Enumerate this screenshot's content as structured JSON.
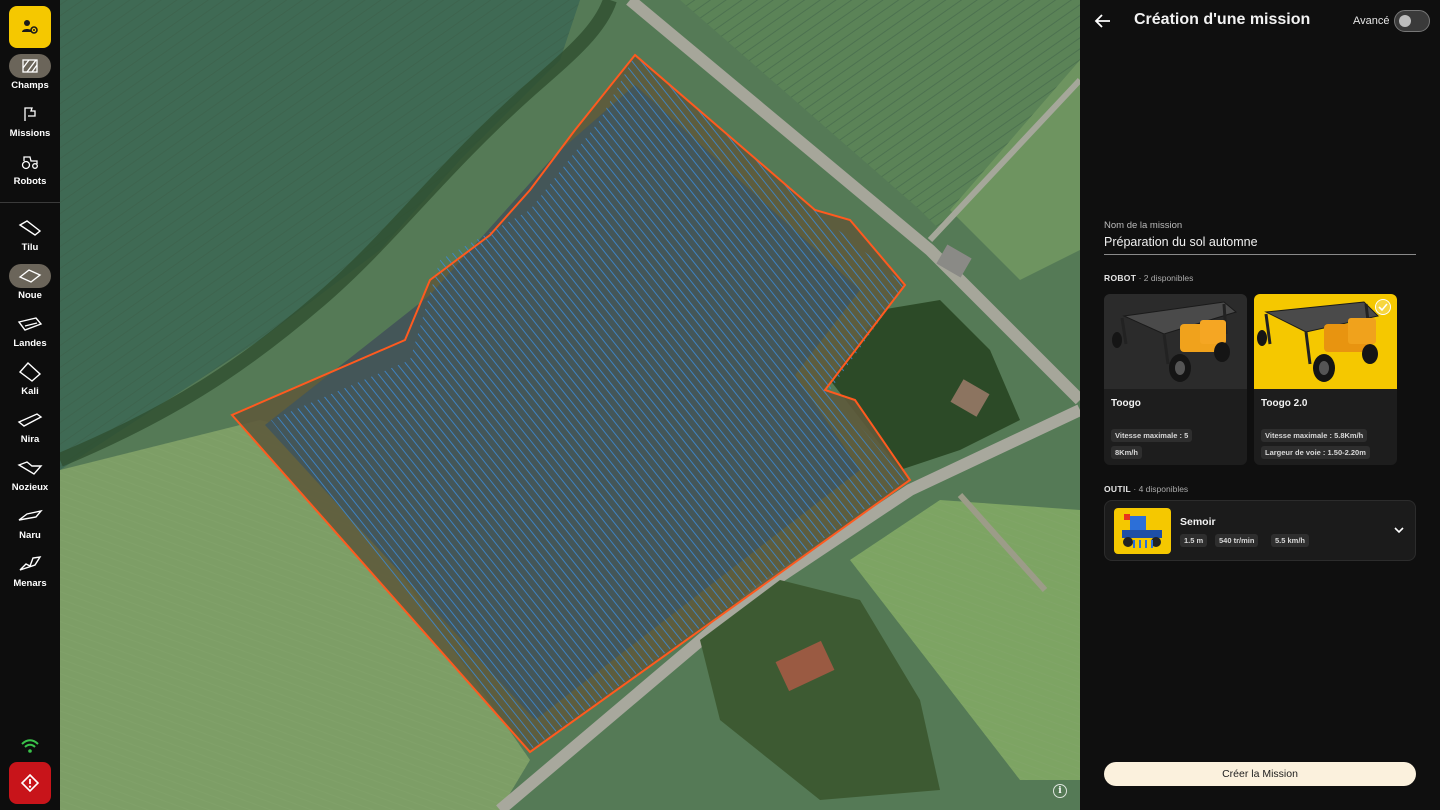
{
  "sidebar": {
    "logo_icon": "farmer-settings-icon",
    "items": [
      {
        "label": "Champs",
        "icon": "field-hatch-icon",
        "active": true
      },
      {
        "label": "Missions",
        "icon": "flag-route-icon",
        "active": false
      },
      {
        "label": "Robots",
        "icon": "tractor-icon",
        "active": false
      },
      {
        "label": "Tilu",
        "icon": "parcel-shape-icon",
        "active": false
      },
      {
        "label": "Noue",
        "icon": "parcel-shape-icon",
        "active": true
      },
      {
        "label": "Landes",
        "icon": "parcel-shape-icon",
        "active": false
      },
      {
        "label": "Kali",
        "icon": "parcel-shape-icon",
        "active": false
      },
      {
        "label": "Nira",
        "icon": "parcel-shape-icon",
        "active": false
      },
      {
        "label": "Nozieux",
        "icon": "parcel-shape-icon",
        "active": false
      },
      {
        "label": "Naru",
        "icon": "parcel-shape-icon",
        "active": false
      },
      {
        "label": "Menars",
        "icon": "parcel-shape-icon",
        "active": false
      }
    ],
    "status_icon": "wifi-icon",
    "emergency_icon": "emergency-stop-icon"
  },
  "map": {
    "info_label": "i"
  },
  "panel": {
    "title": "Création d'une mission",
    "advanced_label": "Avancé",
    "advanced_on": false,
    "mission_name_label": "Nom de la mission",
    "mission_name_value": "Préparation du sol automne",
    "robot_section": {
      "title": "ROBOT",
      "sub": "· 2 disponibles"
    },
    "robots": [
      {
        "name": "Toogo",
        "specs": [
          "Vitesse maximale : 5",
          "8Km/h"
        ],
        "selected": false
      },
      {
        "name": "Toogo 2.0",
        "specs": [
          "Vitesse maximale : 5.8Km/h",
          "Largeur de voie : 1.50-2.20m"
        ],
        "selected": true
      }
    ],
    "tool_section": {
      "title": "OUTIL",
      "sub": "· 4 disponibles"
    },
    "tool": {
      "name": "Semoir",
      "chips": [
        "1.5 m",
        "540 tr/min",
        "5.5 km/h"
      ]
    },
    "create_button": "Créer la Mission"
  },
  "colors": {
    "accent": "#f5c800",
    "emergency": "#c8141a",
    "field_border": "#ff5a1f",
    "track_lines": "#3d8bd6",
    "button_bg": "#fbf1dd"
  }
}
